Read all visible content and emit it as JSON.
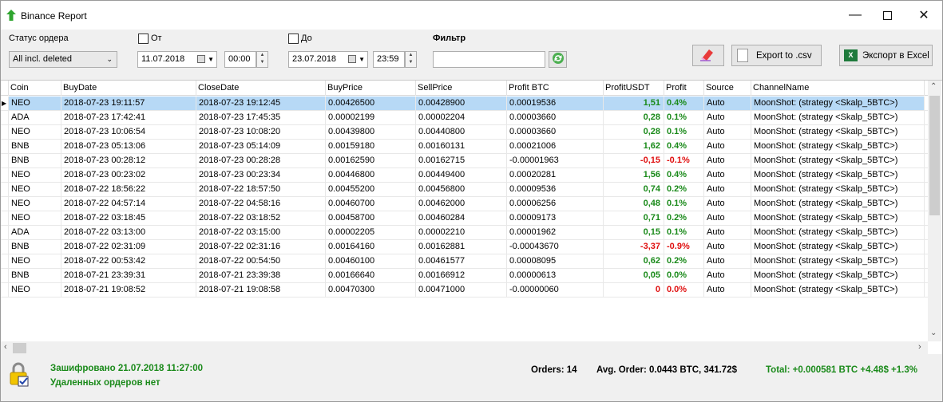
{
  "window": {
    "title": "Binance Report"
  },
  "filters": {
    "status_label": "Статус ордера",
    "status_value": "All incl. deleted",
    "from_label": "От",
    "from_date": "11.07.2018",
    "from_time": "00:00",
    "to_label": "До",
    "to_date": "23.07.2018",
    "to_time": "23:59",
    "filter_label": "Фильтр",
    "filter_value": ""
  },
  "toolbar": {
    "export_csv": "Export to .csv",
    "export_excel": "Экспорт в Excel"
  },
  "table": {
    "columns": [
      "Coin",
      "BuyDate",
      "CloseDate",
      "BuyPrice",
      "SellPrice",
      "Profit BTC",
      "ProfitUSDT",
      "Profit",
      "Source",
      "ChannelName"
    ],
    "rows": [
      [
        "NEO",
        "2018-07-23 19:11:57",
        "2018-07-23 19:12:45",
        "0.00426500",
        "0.00428900",
        "0.00019536",
        "1,51",
        "0.4%",
        "Auto",
        "MoonShot: (strategy <Skalp_5BTC>)"
      ],
      [
        "ADA",
        "2018-07-23 17:42:41",
        "2018-07-23 17:45:35",
        "0.00002199",
        "0.00002204",
        "0.00003660",
        "0,28",
        "0.1%",
        "Auto",
        "MoonShot: (strategy <Skalp_5BTC>)"
      ],
      [
        "NEO",
        "2018-07-23 10:06:54",
        "2018-07-23 10:08:20",
        "0.00439800",
        "0.00440800",
        "0.00003660",
        "0,28",
        "0.1%",
        "Auto",
        "MoonShot: (strategy <Skalp_5BTC>)"
      ],
      [
        "BNB",
        "2018-07-23 05:13:06",
        "2018-07-23 05:14:09",
        "0.00159180",
        "0.00160131",
        "0.00021006",
        "1,62",
        "0.4%",
        "Auto",
        "MoonShot: (strategy <Skalp_5BTC>)"
      ],
      [
        "BNB",
        "2018-07-23 00:28:12",
        "2018-07-23 00:28:28",
        "0.00162590",
        "0.00162715",
        "-0.00001963",
        "-0,15",
        "-0.1%",
        "Auto",
        "MoonShot: (strategy <Skalp_5BTC>)"
      ],
      [
        "NEO",
        "2018-07-23 00:23:02",
        "2018-07-23 00:23:34",
        "0.00446800",
        "0.00449400",
        "0.00020281",
        "1,56",
        "0.4%",
        "Auto",
        "MoonShot: (strategy <Skalp_5BTC>)"
      ],
      [
        "NEO",
        "2018-07-22 18:56:22",
        "2018-07-22 18:57:50",
        "0.00455200",
        "0.00456800",
        "0.00009536",
        "0,74",
        "0.2%",
        "Auto",
        "MoonShot: (strategy <Skalp_5BTC>)"
      ],
      [
        "NEO",
        "2018-07-22 04:57:14",
        "2018-07-22 04:58:16",
        "0.00460700",
        "0.00462000",
        "0.00006256",
        "0,48",
        "0.1%",
        "Auto",
        "MoonShot: (strategy <Skalp_5BTC>)"
      ],
      [
        "NEO",
        "2018-07-22 03:18:45",
        "2018-07-22 03:18:52",
        "0.00458700",
        "0.00460284",
        "0.00009173",
        "0,71",
        "0.2%",
        "Auto",
        "MoonShot: (strategy <Skalp_5BTC>)"
      ],
      [
        "ADA",
        "2018-07-22 03:13:00",
        "2018-07-22 03:15:00",
        "0.00002205",
        "0.00002210",
        "0.00001962",
        "0,15",
        "0.1%",
        "Auto",
        "MoonShot: (strategy <Skalp_5BTC>)"
      ],
      [
        "BNB",
        "2018-07-22 02:31:09",
        "2018-07-22 02:31:16",
        "0.00164160",
        "0.00162881",
        "-0.00043670",
        "-3,37",
        "-0.9%",
        "Auto",
        "MoonShot: (strategy <Skalp_5BTC>)"
      ],
      [
        "NEO",
        "2018-07-22 00:53:42",
        "2018-07-22 00:54:50",
        "0.00460100",
        "0.00461577",
        "0.00008095",
        "0,62",
        "0.2%",
        "Auto",
        "MoonShot: (strategy <Skalp_5BTC>)"
      ],
      [
        "BNB",
        "2018-07-21 23:39:31",
        "2018-07-21 23:39:38",
        "0.00166640",
        "0.00166912",
        "0.00000613",
        "0,05",
        "0.0%",
        "Auto",
        "MoonShot: (strategy <Skalp_5BTC>)"
      ],
      [
        "NEO",
        "2018-07-21 19:08:52",
        "2018-07-21 19:08:58",
        "0.00470300",
        "0.00471000",
        "-0.00000060",
        "0",
        "0.0%",
        "Auto",
        "MoonShot: (strategy <Skalp_5BTC>)"
      ]
    ]
  },
  "footer": {
    "encrypted": "Зашифровано 21.07.2018 11:27:00",
    "deleted": "Удаленных ордеров нет",
    "orders": "Orders: 14",
    "avg_order": "Avg. Order:  0.0443 BTC,  341.72$",
    "total": "Total: +0.000581 BTC  +4.48$  +1.3%"
  },
  "colors": {
    "positive": "#1a8a1a",
    "negative": "#e01010",
    "selection": "#b7d9f6"
  }
}
